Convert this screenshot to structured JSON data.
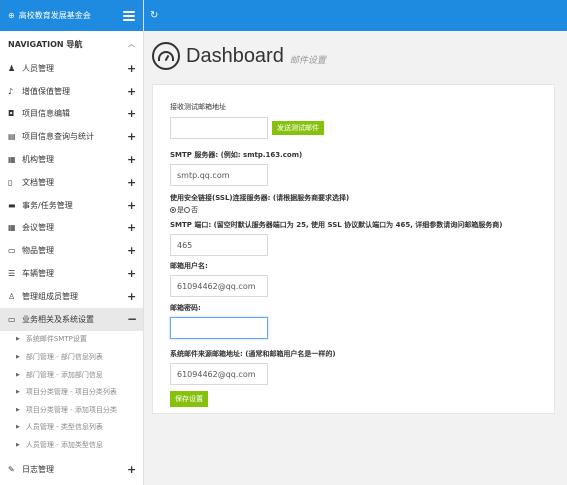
{
  "brand": {
    "mark": "⊕",
    "title": "高校教育发展基金会"
  },
  "nav": {
    "header": "NAVIGATION 导航",
    "items": [
      {
        "icon": "♟",
        "label": "人员管理"
      },
      {
        "icon": "♪",
        "label": "增值保值管理"
      },
      {
        "icon": "◘",
        "label": "项目信息编辑"
      },
      {
        "icon": "▤",
        "label": "项目信息查询与统计"
      },
      {
        "icon": "▦",
        "label": "机构管理"
      },
      {
        "icon": "▯",
        "label": "文档管理"
      },
      {
        "icon": "▬",
        "label": "事务/任务管理"
      },
      {
        "icon": "▦",
        "label": "会议管理"
      },
      {
        "icon": "▭",
        "label": "物品管理"
      },
      {
        "icon": "☰",
        "label": "车辆管理"
      },
      {
        "icon": "♙",
        "label": "管理组成员管理"
      }
    ],
    "active": {
      "icon": "▭",
      "label": "业务相关及系统设置"
    },
    "subitems": [
      "系统邮件SMTP设置",
      "部门管理 - 部门信息列表",
      "部门管理 - 添加部门信息",
      "项目分类管理 - 项目分类列表",
      "项目分类管理 - 添加项目分类",
      "人员管理 - 类型信息列表",
      "人员管理 - 添加类型信息"
    ],
    "last": {
      "icon": "✎",
      "label": "日志管理"
    }
  },
  "header": {
    "title": "Dashboard",
    "subtitle": "邮件设置"
  },
  "form": {
    "test_email_label": "接收测试邮箱地址",
    "test_email_value": "",
    "send_test_button": "发送测试邮件",
    "smtp_label": "SMTP 服务器: (例如: smtp.163.com)",
    "smtp_value": "smtp.qq.com",
    "ssl_label": "使用安全链接(SSL)连接服务器: (请根据服务商要求选择)",
    "ssl_yes": "是",
    "ssl_no": "否",
    "port_label": "SMTP 端口: (留空时默认服务器端口为 25, 使用 SSL 协议默认端口为 465, 详细参数请询问邮箱服务商)",
    "port_value": "465",
    "username_label": "邮箱用户名:",
    "username_value": "61094462@qq.com",
    "password_label": "邮箱密码:",
    "password_value": "",
    "from_label": "系统邮件来源邮箱地址: (通常和邮箱用户名是一样的)",
    "from_value": "61094462@qq.com",
    "save_button": "保存设置"
  },
  "colors": {
    "primary": "#1e8be0",
    "green": "#86c20d"
  }
}
